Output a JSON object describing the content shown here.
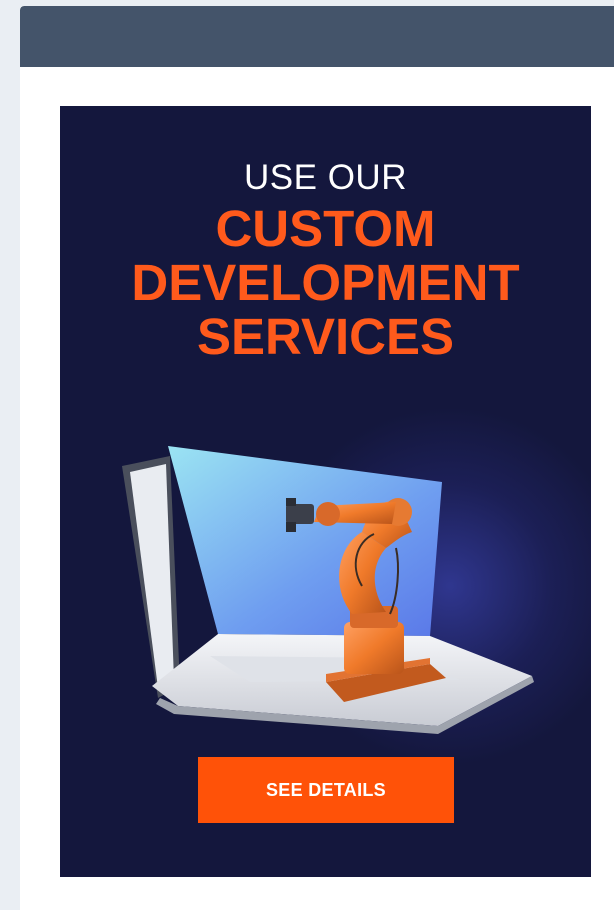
{
  "ad": {
    "eyebrow": "USE OUR",
    "headline_lines": [
      "CUSTOM",
      "DEVELOPMENT",
      "SERVICES"
    ],
    "cta_label": "SEE DETAILS",
    "image_subject": "laptop with orange robotic arm",
    "colors": {
      "background": "#14173d",
      "accent": "#ff5a1c",
      "header": "#44546a"
    }
  }
}
